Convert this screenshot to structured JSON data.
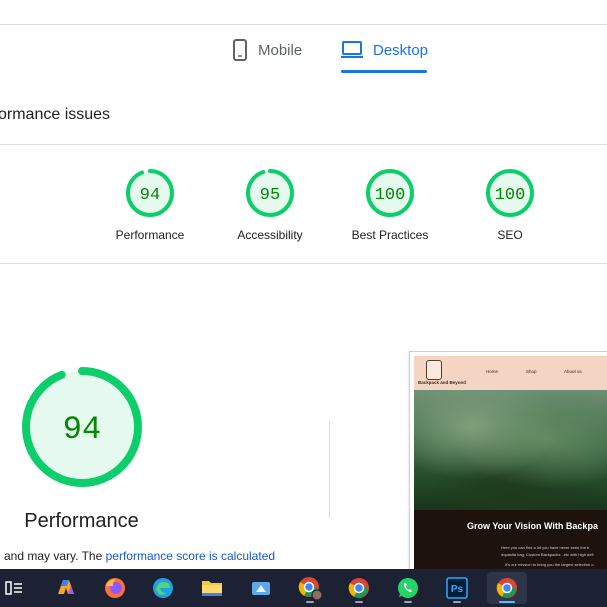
{
  "tabs": {
    "mobile": {
      "label": "Mobile",
      "icon": "phone-icon"
    },
    "desktop": {
      "label": "Desktop",
      "icon": "laptop-icon",
      "selected": true
    }
  },
  "issues_text": "ormance issues",
  "scores": [
    {
      "value": "94",
      "label": "Performance"
    },
    {
      "value": "95",
      "label": "Accessibility"
    },
    {
      "value": "100",
      "label": "Best Practices"
    },
    {
      "value": "100",
      "label": "SEO"
    }
  ],
  "performance": {
    "score": "94",
    "score_fraction": 0.94,
    "title": "Performance",
    "note_prefix": "and may vary. The ",
    "note_link": "performance score is calculated"
  },
  "screenshot": {
    "brand": "Backpack and Beyond",
    "nav_links": [
      "Home",
      "Shop",
      "About us"
    ],
    "headline": "Grow Your Vision With Backpa",
    "sub1": "Here you can find a lot you have never seen the b",
    "sub2": "dopasita bag. Custom Backpacks...etc with high defi",
    "sub3": "It's our mission to bring you the largest selection o"
  },
  "colors": {
    "pass_green": "#0cce6b",
    "pass_green_text": "#008800",
    "pass_fill": "#e6f9ee",
    "accent_blue": "#1a73e8",
    "taskbar": "#1c2233"
  },
  "taskbar": {
    "items": [
      {
        "icon": "task-view-icon"
      },
      {
        "icon": "copilot-icon"
      },
      {
        "icon": "firefox-icon"
      },
      {
        "icon": "edge-icon"
      },
      {
        "icon": "file-explorer-icon"
      },
      {
        "icon": "app-icon"
      },
      {
        "icon": "chrome-profile-icon"
      },
      {
        "icon": "chrome-icon"
      },
      {
        "icon": "whatsapp-icon"
      },
      {
        "icon": "photoshop-icon",
        "text": "Ps"
      },
      {
        "icon": "chrome-icon",
        "active": true
      }
    ]
  }
}
